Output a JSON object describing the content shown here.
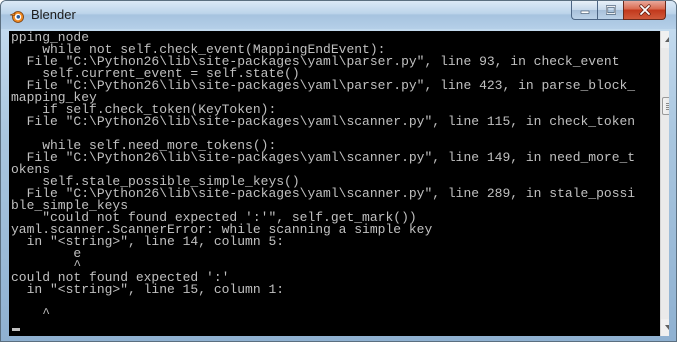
{
  "window": {
    "title": "Blender",
    "icon": "blender-logo-icon",
    "controls": [
      "minimize-icon",
      "maximize-icon",
      "close-icon"
    ]
  },
  "console": {
    "lines": [
      "pping_node",
      "    while not self.check_event(MappingEndEvent):",
      "  File \"C:\\Python26\\lib\\site-packages\\yaml\\parser.py\", line 93, in check_event",
      "    self.current_event = self.state()",
      "  File \"C:\\Python26\\lib\\site-packages\\yaml\\parser.py\", line 423, in parse_block_",
      "mapping_key",
      "    if self.check_token(KeyToken):",
      "  File \"C:\\Python26\\lib\\site-packages\\yaml\\scanner.py\", line 115, in check_token",
      "",
      "    while self.need_more_tokens():",
      "  File \"C:\\Python26\\lib\\site-packages\\yaml\\scanner.py\", line 149, in need_more_t",
      "okens",
      "    self.stale_possible_simple_keys()",
      "  File \"C:\\Python26\\lib\\site-packages\\yaml\\scanner.py\", line 289, in stale_possi",
      "ble_simple_keys",
      "    \"could not found expected ':'\", self.get_mark())",
      "yaml.scanner.ScannerError: while scanning a simple key",
      "  in \"<string>\", line 14, column 5:",
      "        e",
      "        ^",
      "could not found expected ':'",
      "  in \"<string>\", line 15, column 1:",
      "",
      "    ^"
    ]
  },
  "scrollbar": {
    "up_icon": "scroll-up-arrow-icon",
    "down_icon": "scroll-down-arrow-icon"
  }
}
